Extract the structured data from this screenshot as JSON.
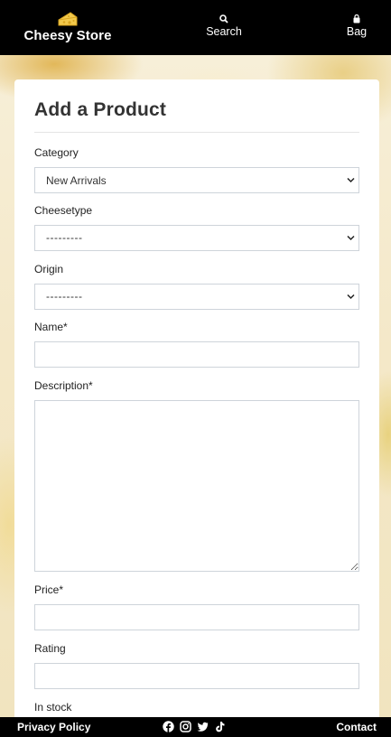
{
  "header": {
    "brand": "Cheesy Store",
    "search_label": "Search",
    "bag_label": "Bag"
  },
  "form": {
    "title": "Add a Product",
    "category": {
      "label": "Category",
      "value": "New Arrivals"
    },
    "cheesetype": {
      "label": "Cheesetype",
      "value": "---------"
    },
    "origin": {
      "label": "Origin",
      "value": "---------"
    },
    "name": {
      "label": "Name*",
      "value": ""
    },
    "description": {
      "label": "Description*",
      "value": ""
    },
    "price": {
      "label": "Price*",
      "value": ""
    },
    "rating": {
      "label": "Rating",
      "value": ""
    },
    "in_stock": {
      "label": "In stock"
    }
  },
  "footer": {
    "privacy": "Privacy Policy",
    "contact": "Contact",
    "socials": [
      "facebook-icon",
      "instagram-icon",
      "twitter-icon",
      "tiktok-icon"
    ]
  },
  "colors": {
    "header_bg": "#000000",
    "card_bg": "#ffffff",
    "border": "#ced4da"
  }
}
